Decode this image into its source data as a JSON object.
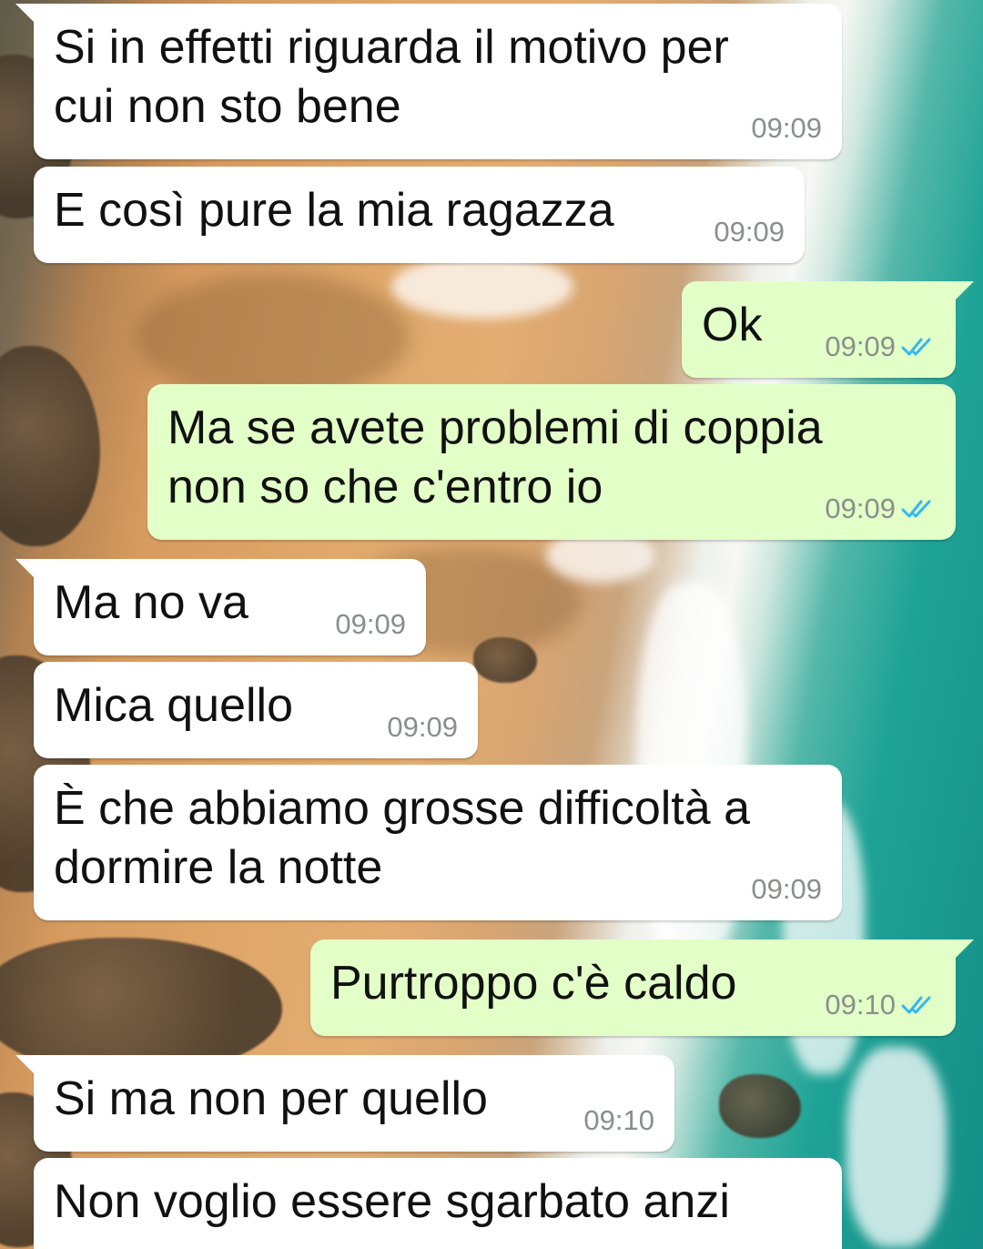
{
  "theme": {
    "incoming_bubble": "#ffffff",
    "outgoing_bubble": "#e2ffc7",
    "time_color": "#8a8f8c",
    "read_tick_color": "#34b7f1"
  },
  "messages": [
    {
      "direction": "incoming",
      "text": "Si in effetti riguarda il motivo per cui non sto bene",
      "time": "09:09"
    },
    {
      "direction": "incoming",
      "text": "E così pure la mia ragazza",
      "time": "09:09"
    },
    {
      "direction": "outgoing",
      "text": "Ok",
      "time": "09:09",
      "status": "read"
    },
    {
      "direction": "outgoing",
      "text": "Ma se avete problemi di coppia non so che c'entro io",
      "time": "09:09",
      "status": "read"
    },
    {
      "direction": "incoming",
      "text": "Ma no va",
      "time": "09:09"
    },
    {
      "direction": "incoming",
      "text": "Mica quello",
      "time": "09:09"
    },
    {
      "direction": "incoming",
      "text": "È che abbiamo grosse difficoltà a dormire la notte",
      "time": "09:09"
    },
    {
      "direction": "outgoing",
      "text": "Purtroppo c'è caldo",
      "time": "09:10",
      "status": "read"
    },
    {
      "direction": "incoming",
      "text": "Si ma non per quello",
      "time": "09:10"
    },
    {
      "direction": "incoming",
      "text": "Non voglio essere sgarbato anzi",
      "time": ""
    }
  ],
  "icons": {
    "read_receipt": "double-check-icon"
  }
}
